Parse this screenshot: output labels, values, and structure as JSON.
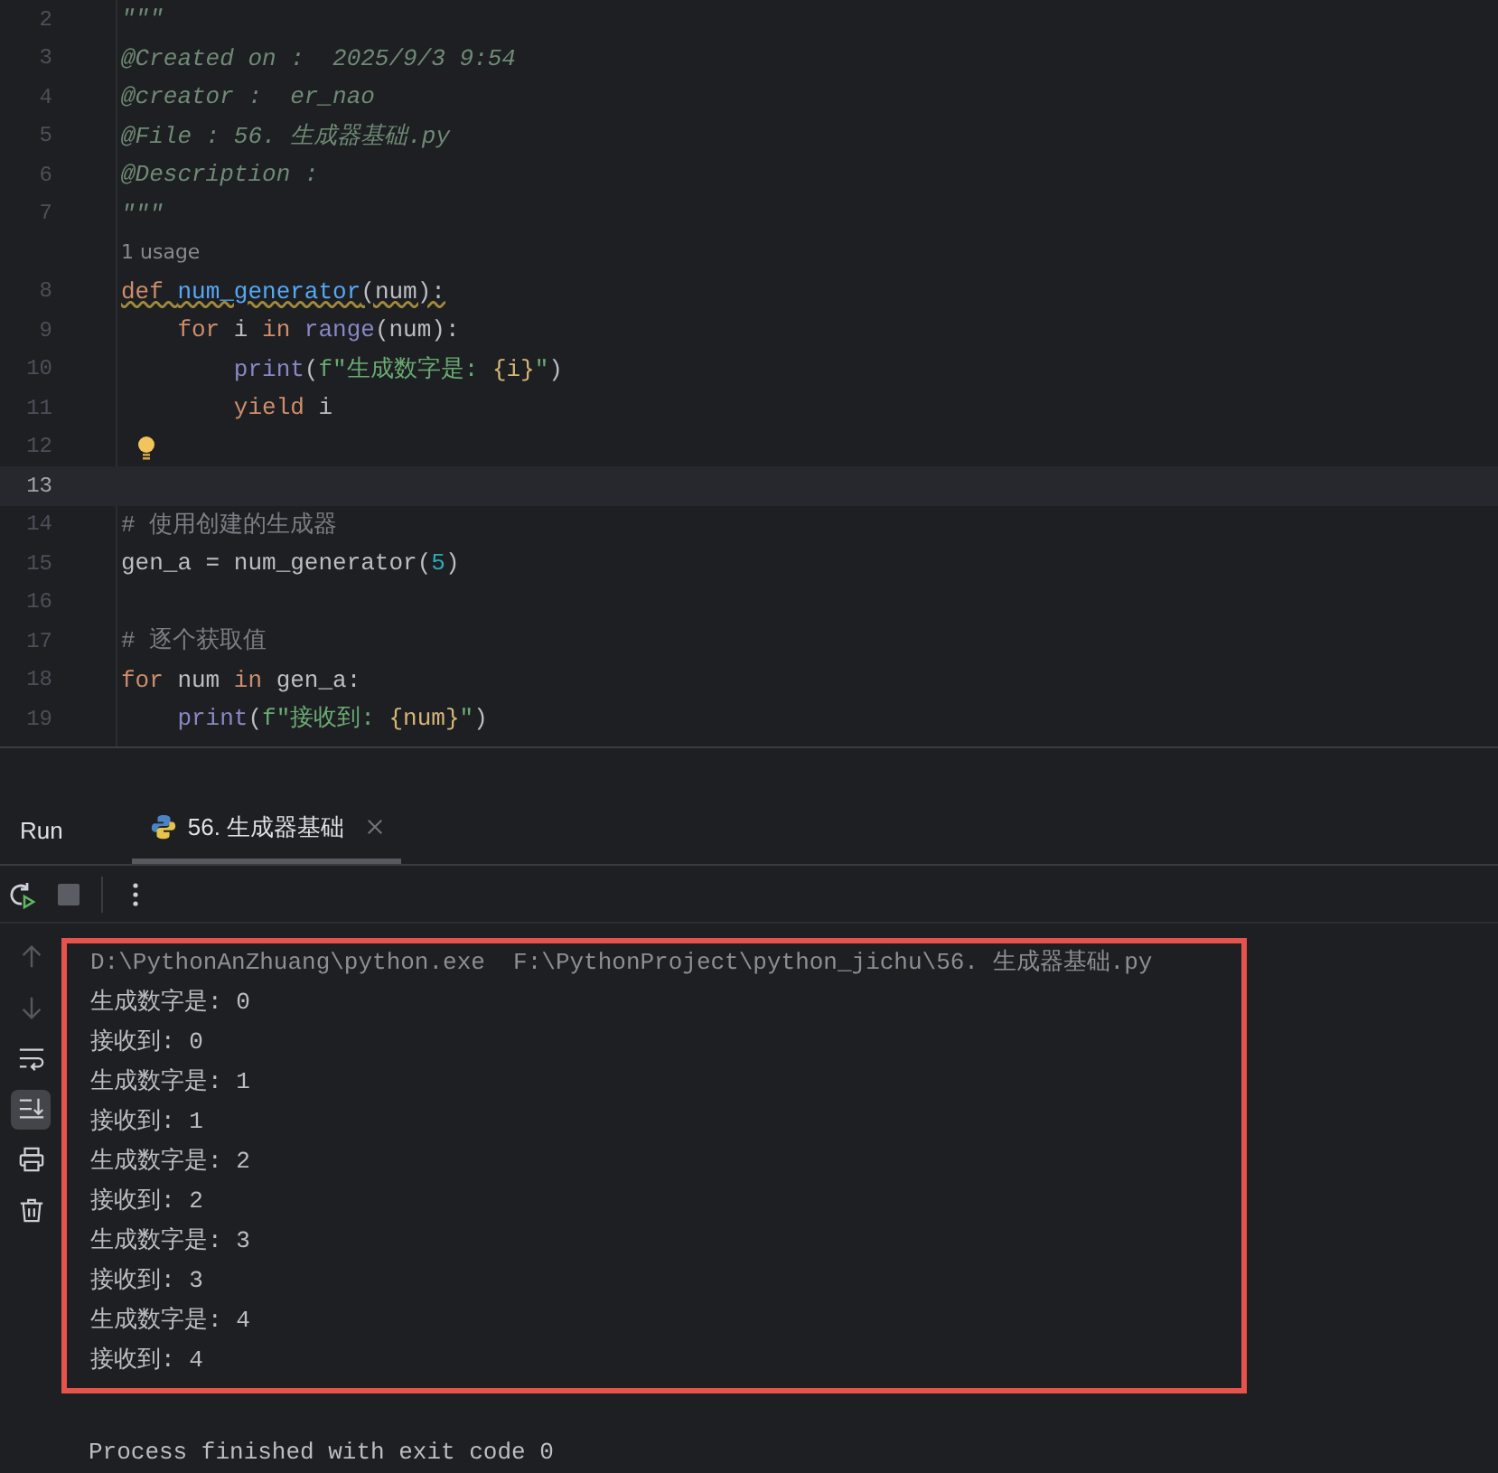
{
  "editor": {
    "lines": [
      {
        "number": "2",
        "current": false,
        "bulb": false,
        "warning": false,
        "tokens": [
          {
            "text": "\"\"\"",
            "kind": "doc"
          }
        ]
      },
      {
        "number": "3",
        "current": false,
        "bulb": false,
        "warning": false,
        "tokens": [
          {
            "text": "@Created on :  2025/9/3 9:54",
            "kind": "doc"
          }
        ]
      },
      {
        "number": "4",
        "current": false,
        "bulb": false,
        "warning": false,
        "tokens": [
          {
            "text": "@creator :  er_nao",
            "kind": "doc"
          }
        ]
      },
      {
        "number": "5",
        "current": false,
        "bulb": false,
        "warning": false,
        "tokens": [
          {
            "text": "@File : 56. 生成器基础.py",
            "kind": "doc"
          }
        ]
      },
      {
        "number": "6",
        "current": false,
        "bulb": false,
        "warning": false,
        "tokens": [
          {
            "text": "@Description :",
            "kind": "doc"
          }
        ]
      },
      {
        "number": "7",
        "current": false,
        "bulb": false,
        "warning": false,
        "tokens": [
          {
            "text": "\"\"\"",
            "kind": "doc"
          }
        ]
      },
      {
        "hint": "1 usage"
      },
      {
        "number": "8",
        "current": false,
        "bulb": false,
        "warning": true,
        "tokens": [
          {
            "text": "def ",
            "kind": "keyword"
          },
          {
            "text": "num_generator",
            "kind": "function"
          },
          {
            "text": "(num):",
            "kind": "plain"
          }
        ]
      },
      {
        "number": "9",
        "current": false,
        "bulb": false,
        "warning": false,
        "tokens": [
          {
            "text": "    for",
            "kind": "keyword"
          },
          {
            "text": " i ",
            "kind": "plain"
          },
          {
            "text": "in ",
            "kind": "keyword"
          },
          {
            "text": "range",
            "kind": "builtin"
          },
          {
            "text": "(num):",
            "kind": "plain"
          }
        ]
      },
      {
        "number": "10",
        "current": false,
        "bulb": false,
        "warning": false,
        "tokens": [
          {
            "text": "        print",
            "kind": "builtin"
          },
          {
            "text": "(",
            "kind": "plain"
          },
          {
            "text": "f\"生成数字是: ",
            "kind": "string"
          },
          {
            "text": "{i}",
            "kind": "brace"
          },
          {
            "text": "\"",
            "kind": "string"
          },
          {
            "text": ")",
            "kind": "plain"
          }
        ]
      },
      {
        "number": "11",
        "current": false,
        "bulb": false,
        "warning": false,
        "tokens": [
          {
            "text": "        yield",
            "kind": "keyword"
          },
          {
            "text": " i",
            "kind": "plain"
          }
        ]
      },
      {
        "number": "12",
        "current": false,
        "bulb": true,
        "warning": false
      },
      {
        "number": "13",
        "current": true,
        "bulb": false,
        "warning": false
      },
      {
        "number": "14",
        "current": false,
        "bulb": false,
        "warning": false,
        "tokens": [
          {
            "text": "# 使用创建的生成器",
            "kind": "comment"
          }
        ]
      },
      {
        "number": "15",
        "current": false,
        "bulb": false,
        "warning": false,
        "tokens": [
          {
            "text": "gen_a = num_generator(",
            "kind": "plain"
          },
          {
            "text": "5",
            "kind": "number"
          },
          {
            "text": ")",
            "kind": "plain"
          }
        ]
      },
      {
        "number": "16",
        "current": false,
        "bulb": false,
        "warning": false
      },
      {
        "number": "17",
        "current": false,
        "bulb": false,
        "warning": false,
        "tokens": [
          {
            "text": "# 逐个获取值",
            "kind": "comment"
          }
        ]
      },
      {
        "number": "18",
        "current": false,
        "bulb": false,
        "warning": false,
        "tokens": [
          {
            "text": "for",
            "kind": "keyword"
          },
          {
            "text": " num ",
            "kind": "plain"
          },
          {
            "text": "in",
            "kind": "keyword"
          },
          {
            "text": " gen_a:",
            "kind": "plain"
          }
        ]
      },
      {
        "number": "19",
        "current": false,
        "bulb": false,
        "warning": false,
        "tokens": [
          {
            "text": "    print",
            "kind": "builtin"
          },
          {
            "text": "(",
            "kind": "plain"
          },
          {
            "text": "f\"接收到: ",
            "kind": "string"
          },
          {
            "text": "{num}",
            "kind": "brace"
          },
          {
            "text": "\"",
            "kind": "string"
          },
          {
            "text": ")",
            "kind": "plain"
          }
        ]
      }
    ]
  },
  "run_panel": {
    "title": "Run",
    "tabs": [
      {
        "label": "56. 生成器基础",
        "selected": true
      }
    ],
    "toolbar": [
      {
        "kind": "rerun"
      },
      {
        "kind": "stop"
      },
      {
        "kind": "more"
      }
    ],
    "sidebar": [
      {
        "kind": "up",
        "selected": false
      },
      {
        "kind": "down",
        "selected": false
      },
      {
        "kind": "wrap",
        "selected": false
      },
      {
        "kind": "scroll-end",
        "selected": true
      },
      {
        "kind": "print",
        "selected": false
      },
      {
        "kind": "trash",
        "selected": false
      }
    ],
    "highlighted_output": {
      "color": "#e5534b",
      "lines": [
        "D:\\PythonAnZhuang\\python.exe  F:\\PythonProject\\python_jichu\\56. 生成器基础.py",
        "生成数字是: 0",
        "接收到: 0",
        "生成数字是: 1",
        "接收到: 1",
        "生成数字是: 2",
        "接收到: 2",
        "生成数字是: 3",
        "接收到: 3",
        "生成数字是: 4",
        "接收到: 4"
      ]
    },
    "exit_message": "Process finished with exit code 0"
  }
}
